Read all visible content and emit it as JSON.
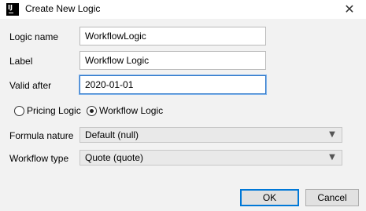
{
  "window": {
    "title": "Create New Logic",
    "app_icon_text": "IJ",
    "close_glyph": "✕"
  },
  "form": {
    "logic_name_label": "Logic name",
    "logic_name_value": "WorkflowLogic",
    "label_label": "Label",
    "label_value": "Workflow Logic",
    "valid_after_label": "Valid after",
    "valid_after_value": "2020-01-01",
    "logic_type_options": [
      {
        "label": "Pricing Logic",
        "selected": false
      },
      {
        "label": "Workflow Logic",
        "selected": true
      }
    ],
    "formula_nature_label": "Formula nature",
    "formula_nature_value": "Default (null)",
    "workflow_type_label": "Workflow type",
    "workflow_type_value": "Quote (quote)"
  },
  "buttons": {
    "ok_label": "OK",
    "cancel_label": "Cancel"
  },
  "colors": {
    "focus_border": "#2f77c9",
    "default_button_border": "#0078d7"
  },
  "icons": {
    "app": "intellij-icon",
    "close": "close-icon",
    "dropdown": "chevron-down-icon"
  }
}
